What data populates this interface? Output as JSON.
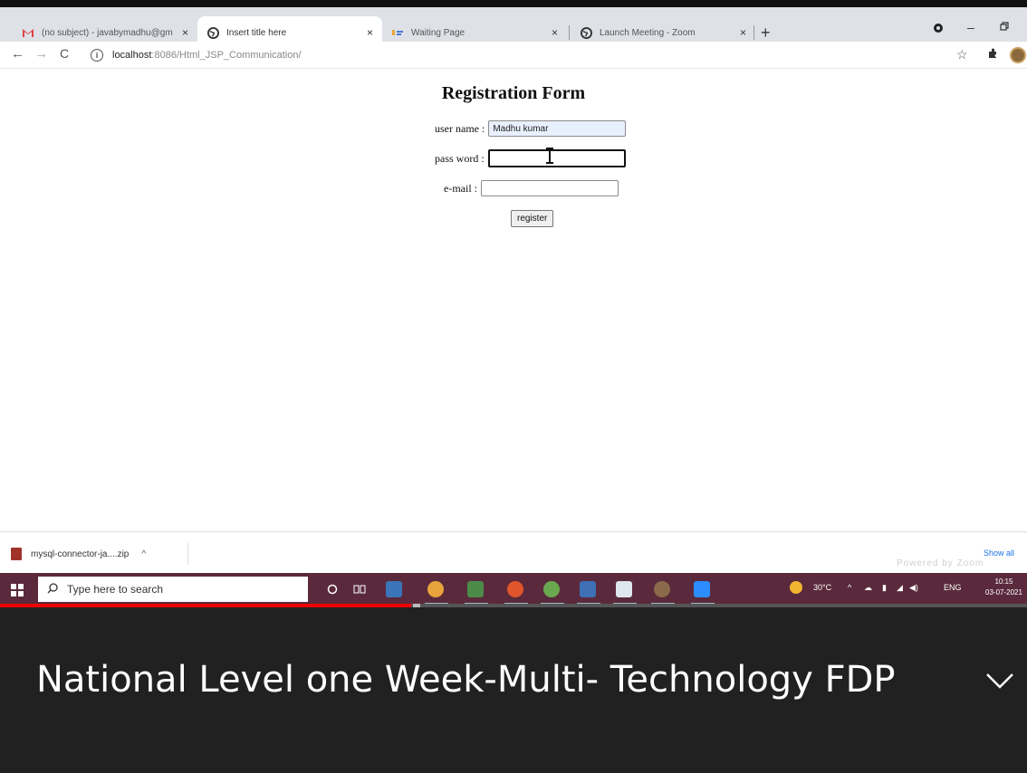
{
  "browser": {
    "tabs": [
      {
        "label": "(no subject) - javabymadhu@gm",
        "icon": "gmail-icon",
        "close": "×"
      },
      {
        "label": "Insert title here",
        "icon": "globe-icon",
        "close": "×"
      },
      {
        "label": "Waiting Page",
        "icon": "zoom-waiting-icon",
        "close": "×"
      },
      {
        "label": "Launch Meeting - Zoom",
        "icon": "globe-icon",
        "close": "×"
      }
    ],
    "new_tab": "+",
    "url_host": "localhost",
    "url_path": ":8086/Html_JSP_Communication/"
  },
  "form": {
    "title": "Registration Form",
    "username_label": "user name :",
    "username_value": "Madhu kumar",
    "password_label": "pass word :",
    "password_value": "",
    "email_label": "e-mail :",
    "email_value": "",
    "register_label": "register"
  },
  "downloads": {
    "file": "mysql-connector-ja....zip",
    "show_all": "Show all",
    "watermark": "Powered by Zoom"
  },
  "taskbar": {
    "search_placeholder": "Type here to search",
    "temperature": "30°C",
    "language": "ENG",
    "time": "10:15",
    "date": "03-07-2021"
  },
  "video": {
    "progress_fraction": 0.4,
    "caption": "National Level one Week-Multi- Technology FDP"
  },
  "colors": {
    "progress": "#ee0000",
    "taskbar": "#5a2a3c",
    "caption_bg": "#212121"
  }
}
